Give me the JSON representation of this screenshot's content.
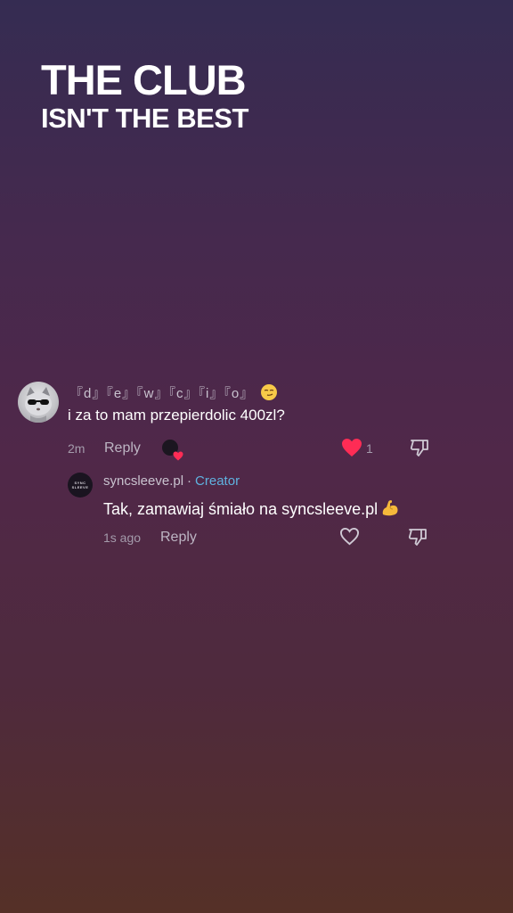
{
  "headline": {
    "line1": "THE CLUB",
    "line2": "ISN'T THE BEST"
  },
  "comment": {
    "username": "『d』『e』『w』『c』『i』『o』",
    "username_emoji": "smirking-face-emoji",
    "text": "i za to mam przepierdolic 400zl?",
    "time": "2m",
    "reply_label": "Reply",
    "like_count": "1",
    "liked": true,
    "liked_by_creator": true,
    "like_color": "#fe2c55"
  },
  "reply": {
    "username": "syncsleeve.pl",
    "separator": "·",
    "badge": "Creator",
    "badge_color": "#5fb2e0",
    "avatar_text": [
      "SYNC",
      "SLEEVE"
    ],
    "text": "Tak, zamawiaj śmiało na syncsleeve.pl",
    "text_emoji": "flexed-biceps-emoji",
    "time": "1s ago",
    "reply_label": "Reply",
    "liked": false
  }
}
